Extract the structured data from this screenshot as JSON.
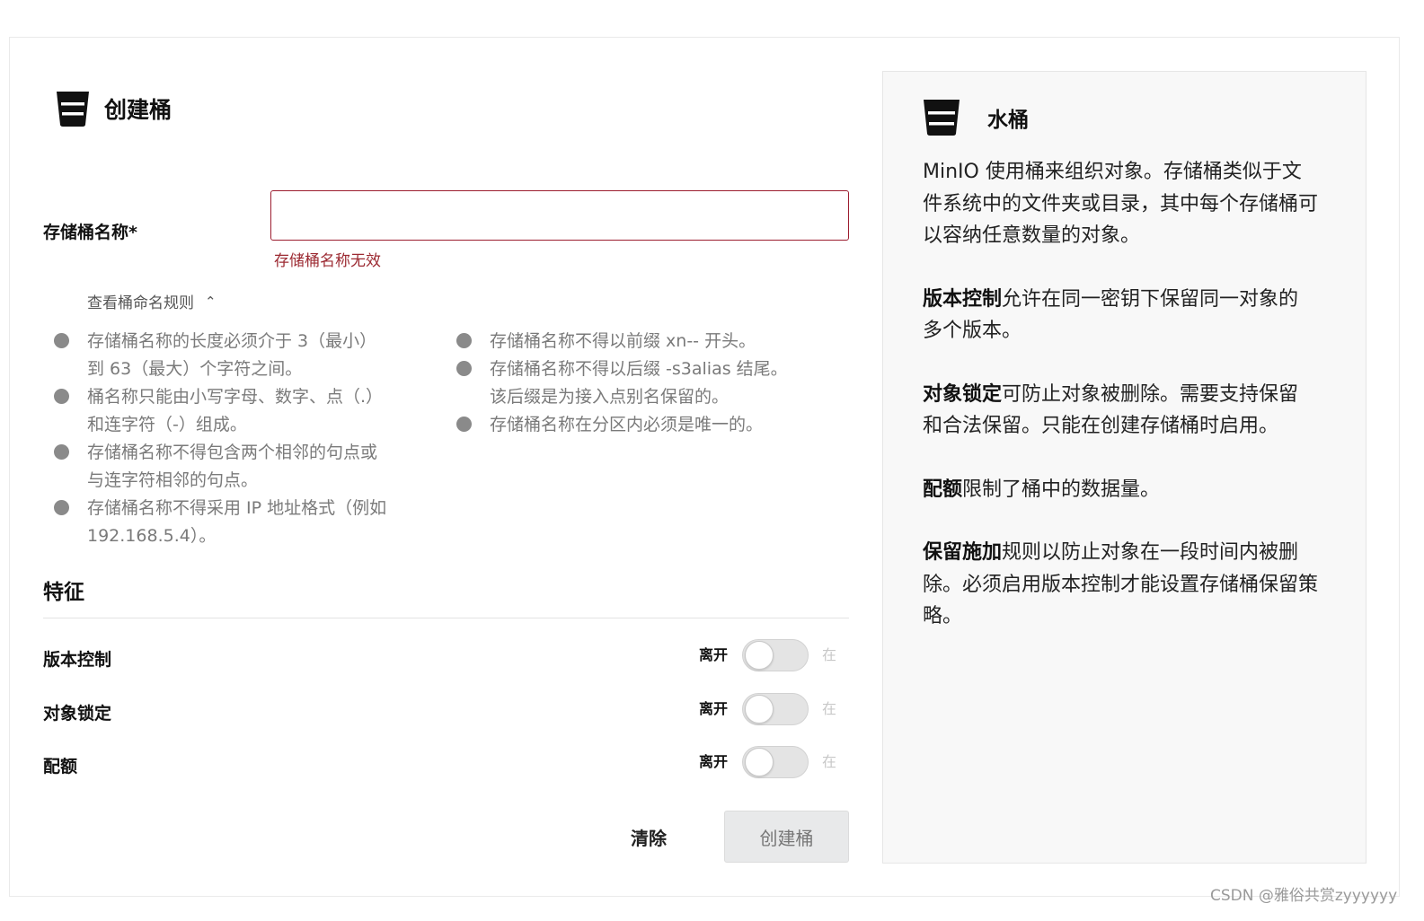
{
  "form": {
    "title": "创建桶",
    "title_icon": "bucket-icon",
    "bucket_name_label": "存储桶名称*",
    "bucket_name_value": "",
    "bucket_name_error": "存储桶名称无效",
    "rules_toggle_label": "查看桶命名规则",
    "rules_toggle_icon": "chevron-up-icon",
    "rules_left": [
      "存储桶名称的长度必须介于 3（最小）到 63（最大）个字符之间。",
      "桶名称只能由小写字母、数字、点（.）和连字符（-）组成。",
      "存储桶名称不得包含两个相邻的句点或与连字符相邻的句点。",
      "存储桶名称不得采用 IP 地址格式（例如 192.168.5.4）。"
    ],
    "rules_right": [
      "存储桶名称不得以前缀 xn-- 开头。",
      "存储桶名称不得以后缀 -s3alias 结尾。该后缀是为接入点别名保留的。",
      "存储桶名称在分区内必须是唯一的。"
    ],
    "features_title": "特征",
    "features": [
      {
        "label": "版本控制",
        "off_label": "离开",
        "on_label": "在",
        "enabled": false
      },
      {
        "label": "对象锁定",
        "off_label": "离开",
        "on_label": "在",
        "enabled": false
      },
      {
        "label": "配额",
        "off_label": "离开",
        "on_label": "在",
        "enabled": false
      }
    ],
    "clear_button": "清除",
    "create_button": "创建桶"
  },
  "help": {
    "title": "水桶",
    "icon": "bucket-icon",
    "intro": "MinIO 使用桶来组织对象。存储桶类似于文件系统中的文件夹或目录，其中每个存储桶可以容纳任意数量的对象。",
    "versioning_term": "版本控制",
    "versioning_text": "允许在同一密钥下保留同一对象的多个版本。",
    "lock_term": "对象锁定",
    "lock_text": "可防止对象被删除。需要支持保留和合法保留。只能在创建存储桶时启用。",
    "quota_term": "配额",
    "quota_text": "限制了桶中的数据量。",
    "retention_term": "保留施加",
    "retention_text": "规则以防止对象在一段时间内被删除。必须启用版本控制才能设置存储桶保留策略。"
  },
  "watermark": "CSDN @雅俗共赏zyyyyyy",
  "colors": {
    "error": "#9c2a32",
    "input_border_error": "#9c1d2f",
    "panel_bg": "#f8f8f8",
    "create_button_bg": "#e8e9ea"
  }
}
